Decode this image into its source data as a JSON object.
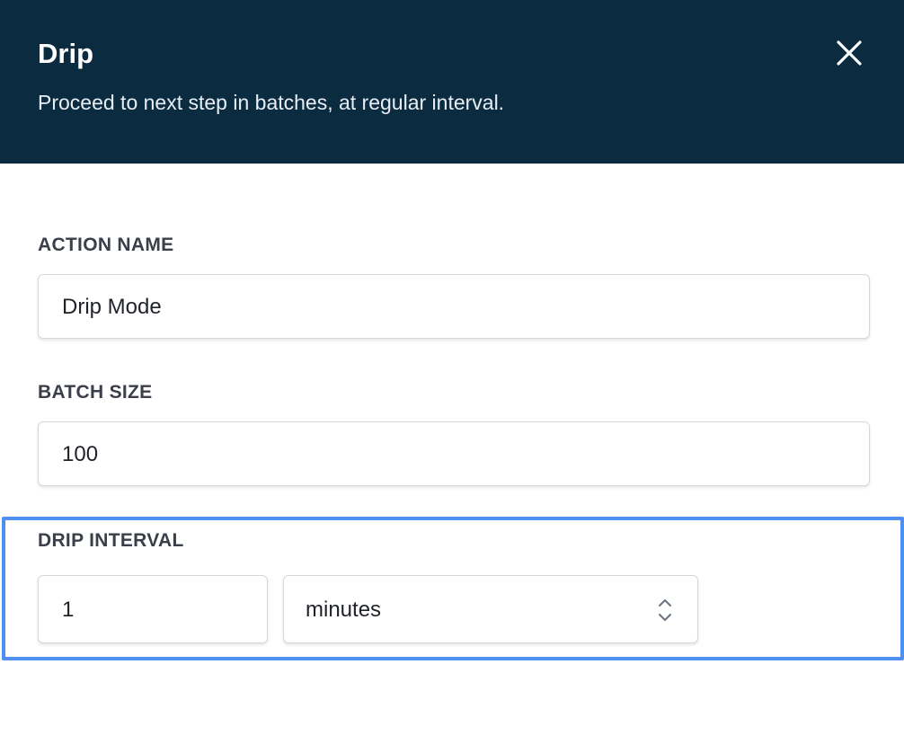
{
  "panel": {
    "title": "Drip",
    "subtitle": "Proceed to next step in batches, at regular interval."
  },
  "icons": {
    "close": "close-icon",
    "select": "chevron-up-down-icon"
  },
  "colors": {
    "header_bg": "#0b2b40",
    "highlight": "#4f8ff0"
  },
  "fields": {
    "action_name": {
      "label": "ACTION NAME",
      "value": "Drip Mode"
    },
    "batch_size": {
      "label": "BATCH SIZE",
      "value": "100"
    },
    "drip_interval": {
      "label": "DRIP INTERVAL",
      "value": "1",
      "unit": "minutes"
    }
  }
}
